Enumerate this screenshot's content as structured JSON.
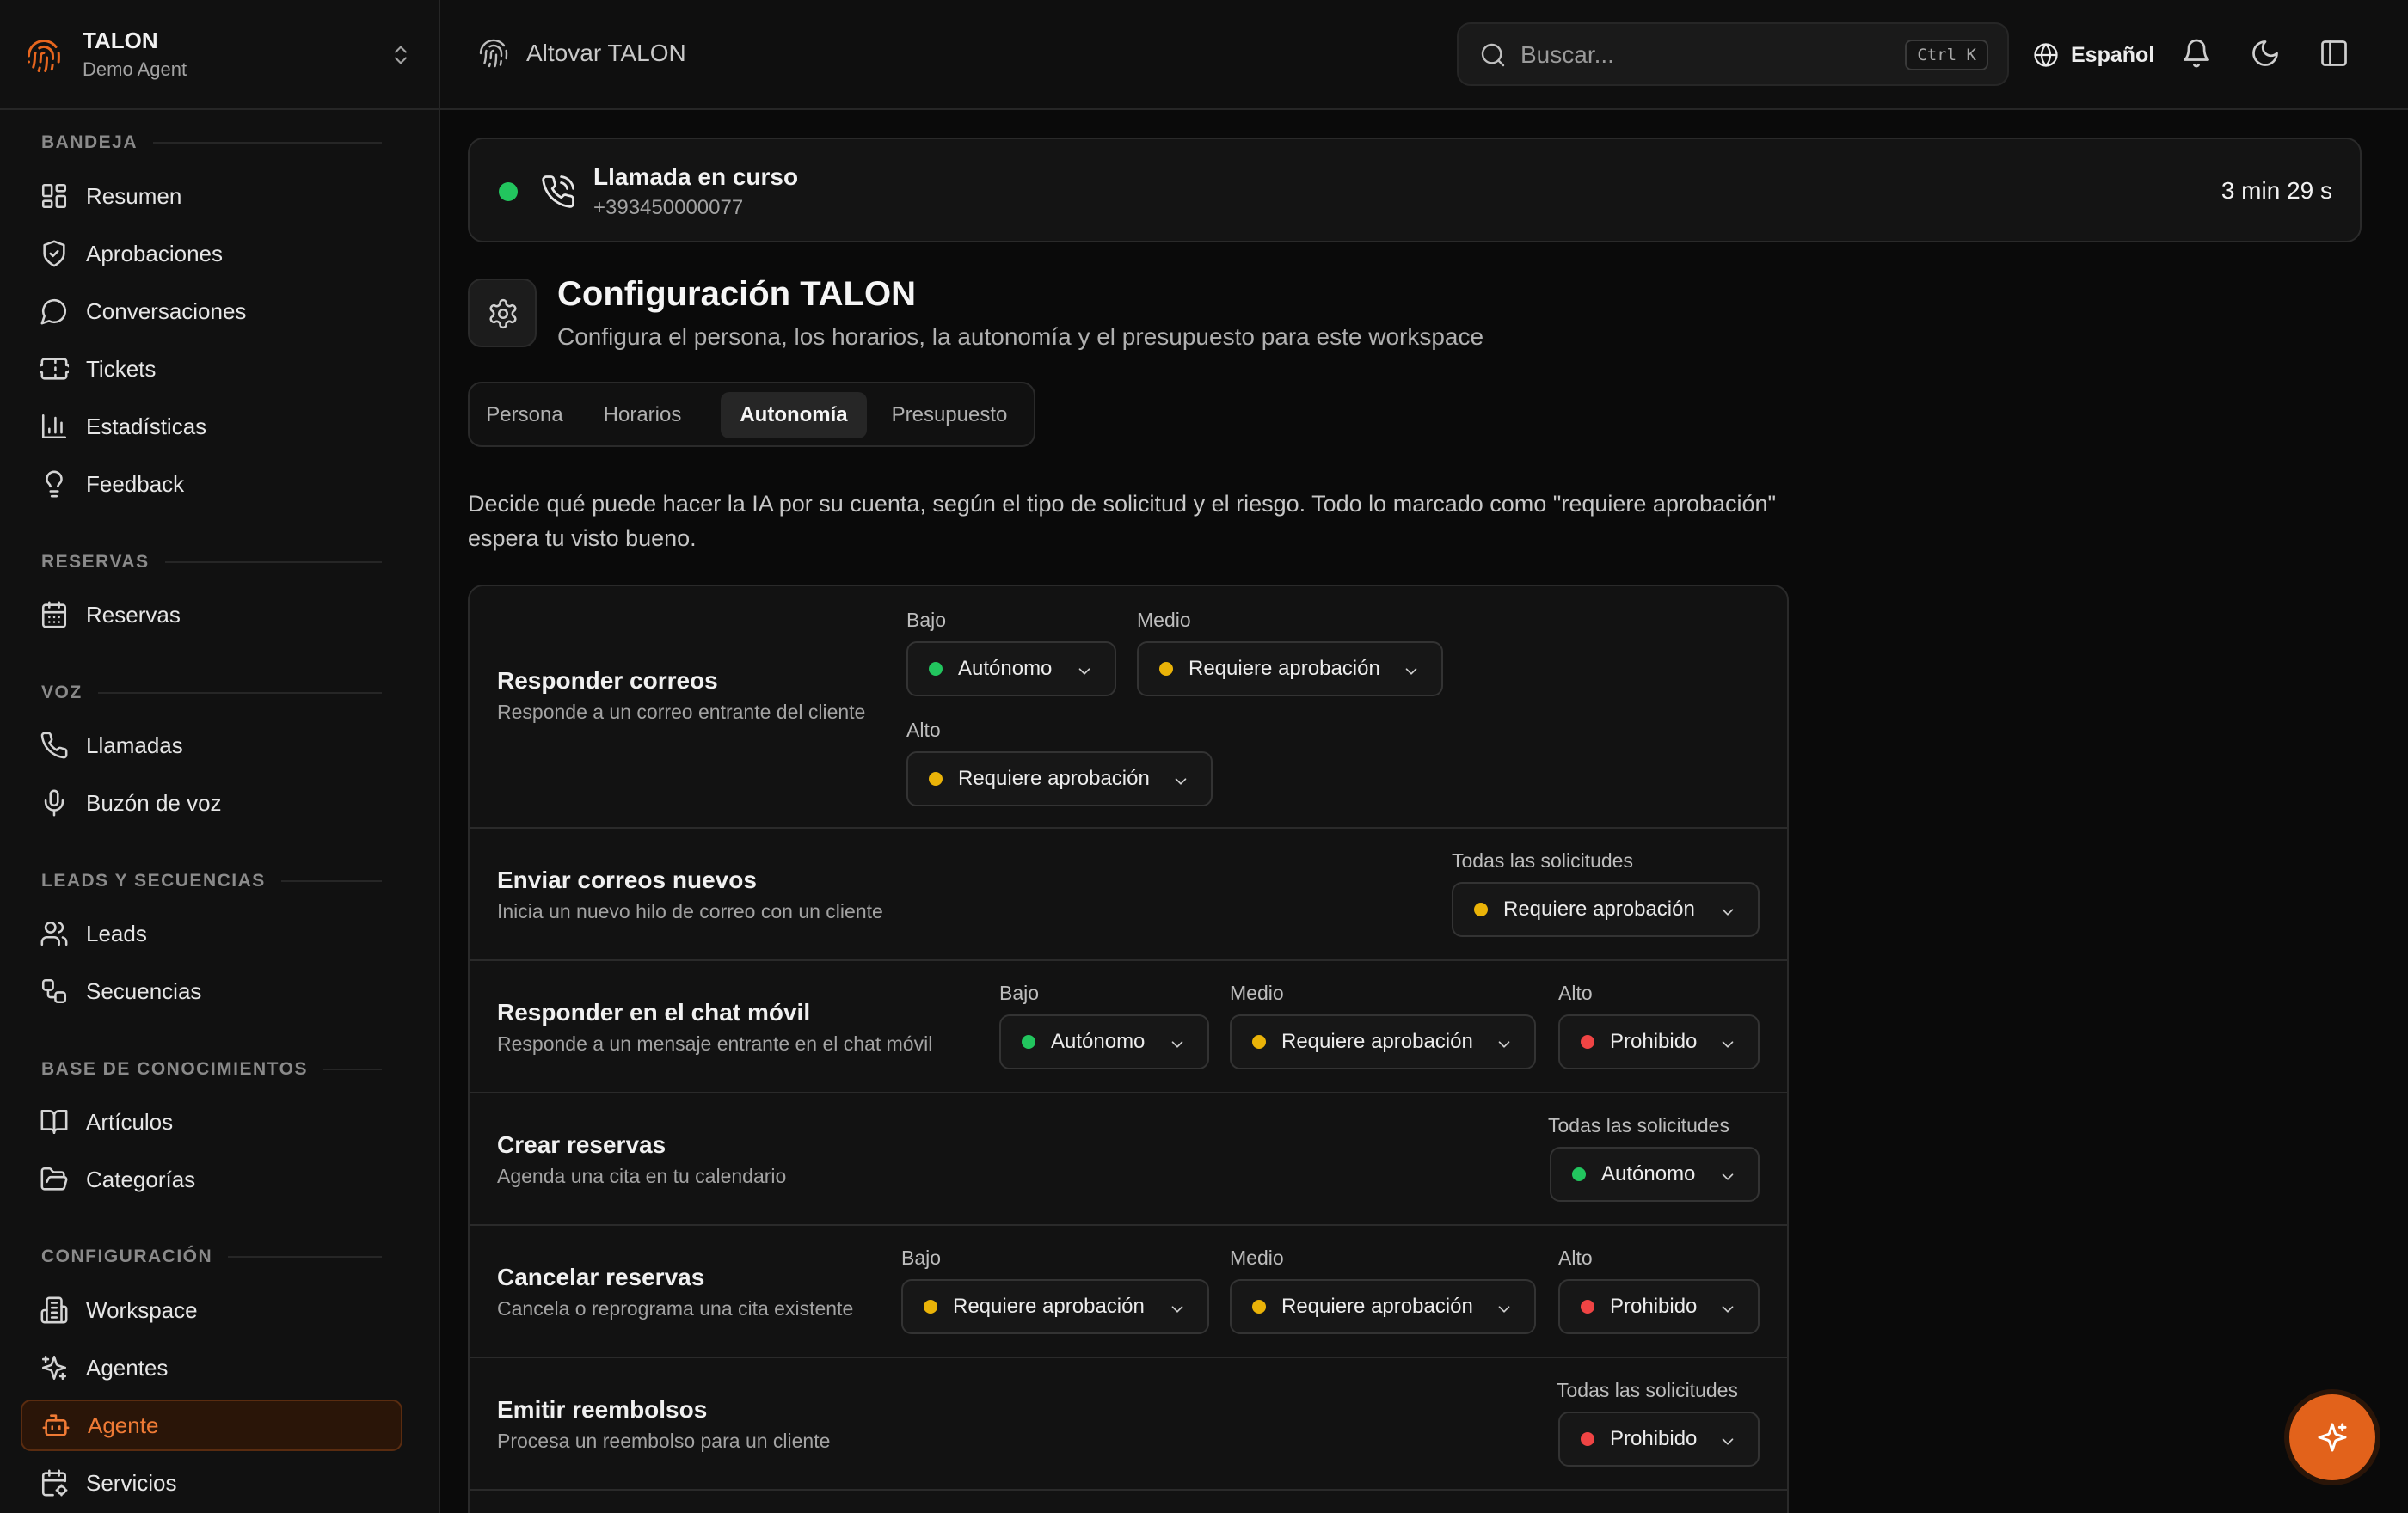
{
  "colors": {
    "accent": "#e8661e",
    "status_green": "#22c55e",
    "status_yellow": "#eab308",
    "status_red": "#ef4444"
  },
  "workspace": {
    "name": "TALON",
    "subtitle": "Demo Agent"
  },
  "sidebar": {
    "sections": [
      {
        "label": "BANDEJA",
        "items": [
          {
            "label": "Resumen",
            "icon": "layout-grid-icon"
          },
          {
            "label": "Aprobaciones",
            "icon": "shield-check-icon"
          },
          {
            "label": "Conversaciones",
            "icon": "message-circle-icon"
          },
          {
            "label": "Tickets",
            "icon": "ticket-icon"
          },
          {
            "label": "Estadísticas",
            "icon": "bar-chart-icon"
          },
          {
            "label": "Feedback",
            "icon": "lightbulb-icon"
          }
        ]
      },
      {
        "label": "RESERVAS",
        "items": [
          {
            "label": "Reservas",
            "icon": "calendar-icon"
          }
        ]
      },
      {
        "label": "VOZ",
        "items": [
          {
            "label": "Llamadas",
            "icon": "phone-icon"
          },
          {
            "label": "Buzón de voz",
            "icon": "microphone-icon"
          }
        ]
      },
      {
        "label": "LEADS Y SECUENCIAS",
        "items": [
          {
            "label": "Leads",
            "icon": "users-icon"
          },
          {
            "label": "Secuencias",
            "icon": "workflow-icon"
          }
        ]
      },
      {
        "label": "BASE DE CONOCIMIENTOS",
        "items": [
          {
            "label": "Artículos",
            "icon": "book-icon"
          },
          {
            "label": "Categorías",
            "icon": "folder-icon"
          }
        ]
      },
      {
        "label": "CONFIGURACIÓN",
        "items": [
          {
            "label": "Workspace",
            "icon": "building-icon"
          },
          {
            "label": "Agentes",
            "icon": "sparkles-icon"
          },
          {
            "label": "Agente",
            "icon": "bot-icon",
            "active": true
          },
          {
            "label": "Servicios",
            "icon": "calendar-cog-icon"
          }
        ]
      }
    ]
  },
  "topbar": {
    "breadcrumb": "Altovar TALON",
    "search_placeholder": "Buscar...",
    "search_shortcut": "Ctrl K",
    "language": "Español"
  },
  "call": {
    "title": "Llamada en curso",
    "number": "+393450000077",
    "duration": "3 min 29 s"
  },
  "page": {
    "title": "Configuración TALON",
    "subtitle": "Configura el persona, los horarios, la autonomía y el presupuesto para este workspace",
    "tabs": [
      {
        "label": "Persona"
      },
      {
        "label": "Horarios"
      },
      {
        "label": "Autonomía",
        "active": true
      },
      {
        "label": "Presupuesto"
      }
    ],
    "intro": "Decide qué puede hacer la IA por su cuenta, según el tipo de solicitud y el riesgo. Todo lo marcado como \"requiere aprobación\" espera tu visto bueno."
  },
  "autonomy": {
    "rows": [
      {
        "title": "Responder correos",
        "description": "Responde a un correo entrante del cliente",
        "controls": [
          {
            "label": "Bajo",
            "value": "Autónomo",
            "status": "green"
          },
          {
            "label": "Medio",
            "value": "Requiere aprobación",
            "status": "yellow"
          },
          {
            "label": "Alto",
            "value": "Requiere aprobación",
            "status": "yellow"
          }
        ]
      },
      {
        "title": "Enviar correos nuevos",
        "description": "Inicia un nuevo hilo de correo con un cliente",
        "controls": [
          {
            "label": "Todas las solicitudes",
            "value": "Requiere aprobación",
            "status": "yellow"
          }
        ]
      },
      {
        "title": "Responder en el chat móvil",
        "description": "Responde a un mensaje entrante en el chat móvil",
        "controls": [
          {
            "label": "Bajo",
            "value": "Autónomo",
            "status": "green"
          },
          {
            "label": "Medio",
            "value": "Requiere aprobación",
            "status": "yellow"
          },
          {
            "label": "Alto",
            "value": "Prohibido",
            "status": "red"
          }
        ]
      },
      {
        "title": "Crear reservas",
        "description": "Agenda una cita en tu calendario",
        "controls": [
          {
            "label": "Todas las solicitudes",
            "value": "Autónomo",
            "status": "green"
          }
        ]
      },
      {
        "title": "Cancelar reservas",
        "description": "Cancela o reprograma una cita existente",
        "controls": [
          {
            "label": "Bajo",
            "value": "Requiere aprobación",
            "status": "yellow"
          },
          {
            "label": "Medio",
            "value": "Requiere aprobación",
            "status": "yellow"
          },
          {
            "label": "Alto",
            "value": "Prohibido",
            "status": "red"
          }
        ]
      },
      {
        "title": "Emitir reembolsos",
        "description": "Procesa un reembolso para un cliente",
        "controls": [
          {
            "label": "Todas las solicitudes",
            "value": "Prohibido",
            "status": "red"
          }
        ]
      }
    ]
  },
  "fab": {
    "icon": "sparkles-icon"
  }
}
